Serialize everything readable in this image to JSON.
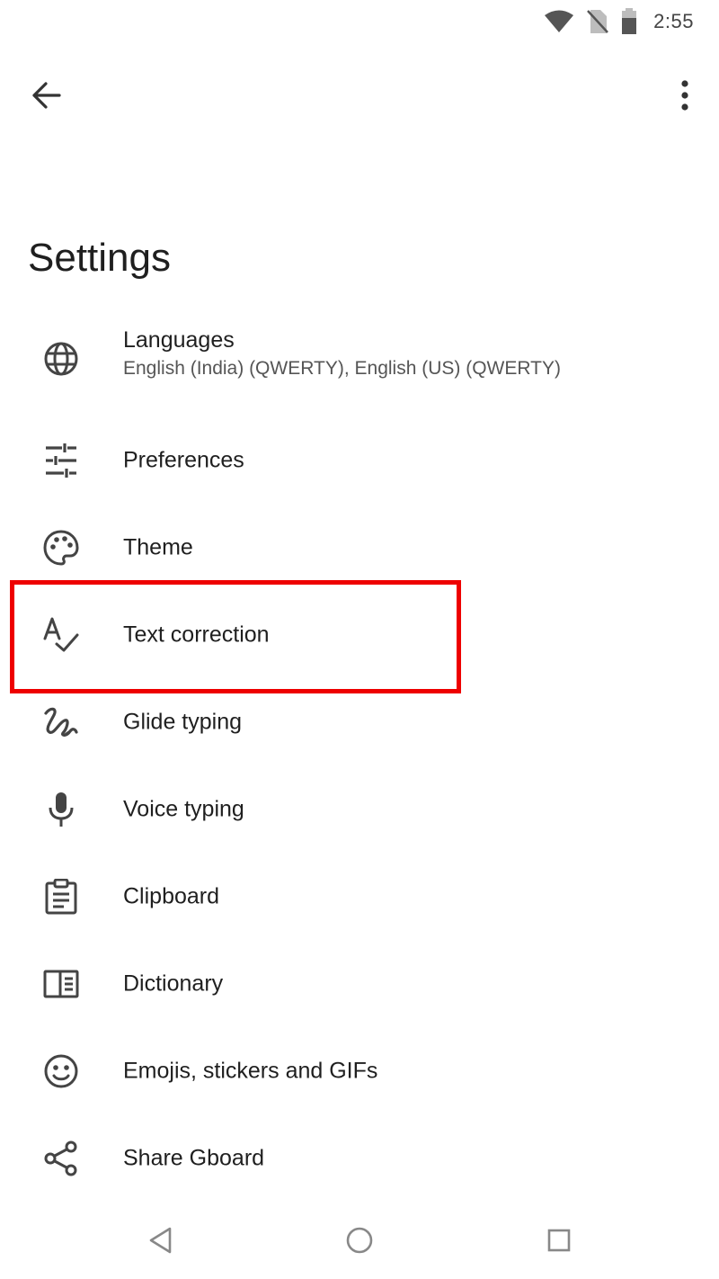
{
  "status_bar": {
    "time": "2:55",
    "icons": [
      "wifi-icon",
      "no-sim-icon",
      "battery-icon"
    ]
  },
  "app_bar": {
    "back_icon": "arrow-back-icon",
    "menu_icon": "more-vert-icon"
  },
  "page": {
    "title": "Settings"
  },
  "settings": {
    "items": [
      {
        "id": "languages",
        "icon": "globe-icon",
        "label": "Languages",
        "sublabel": "English (India) (QWERTY), English (US) (QWERTY)"
      },
      {
        "id": "preferences",
        "icon": "tune-icon",
        "label": "Preferences"
      },
      {
        "id": "theme",
        "icon": "palette-icon",
        "label": "Theme"
      },
      {
        "id": "text-correction",
        "icon": "spellcheck-icon",
        "label": "Text correction"
      },
      {
        "id": "glide-typing",
        "icon": "gesture-icon",
        "label": "Glide typing"
      },
      {
        "id": "voice-typing",
        "icon": "mic-icon",
        "label": "Voice typing"
      },
      {
        "id": "clipboard",
        "icon": "clipboard-icon",
        "label": "Clipboard"
      },
      {
        "id": "dictionary",
        "icon": "dictionary-icon",
        "label": "Dictionary"
      },
      {
        "id": "emojis",
        "icon": "emoji-icon",
        "label": "Emojis, stickers and GIFs"
      },
      {
        "id": "share-gboard",
        "icon": "share-icon",
        "label": "Share Gboard"
      }
    ]
  },
  "highlight": {
    "target": "text-correction",
    "color": "#ee0000"
  },
  "nav_bar": {
    "buttons": [
      "back-triangle-icon",
      "home-circle-icon",
      "recents-square-icon"
    ]
  },
  "colors": {
    "icon": "#444444",
    "text_primary": "#1f1f1f",
    "text_secondary": "#555555"
  }
}
